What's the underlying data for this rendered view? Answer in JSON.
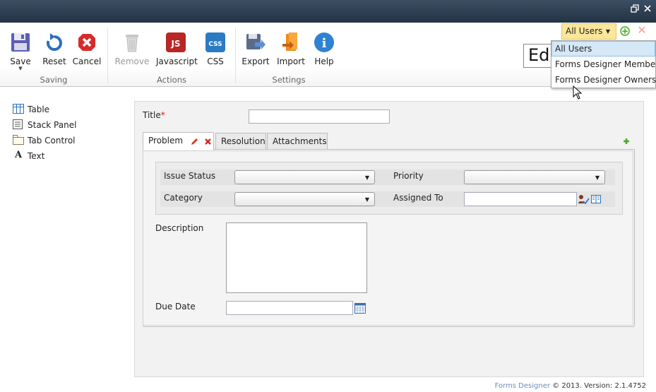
{
  "window": {
    "restore_icon": "restore-window-icon",
    "close_icon": "close-window-icon"
  },
  "ribbon": {
    "groups": [
      {
        "label": "Saving"
      },
      {
        "label": "Actions"
      },
      {
        "label": "Settings"
      }
    ],
    "buttons": {
      "save": "Save",
      "reset": "Reset",
      "cancel": "Cancel",
      "remove": "Remove",
      "javascript": "Javascript",
      "css": "CSS",
      "export": "Export",
      "import": "Import",
      "help": "Help"
    },
    "js_badge": "JS",
    "css_badge": "CSS",
    "help_badge": "i"
  },
  "user_selector": {
    "selected": "All Users",
    "options": [
      "All Users",
      "Forms Designer Members",
      "Forms Designer Owners"
    ],
    "hovered_index": 0,
    "obscured_box_text": "Edi"
  },
  "toolbox": {
    "items": [
      {
        "label": "Table",
        "icon": "table-icon"
      },
      {
        "label": "Stack Panel",
        "icon": "stack-panel-icon"
      },
      {
        "label": "Tab Control",
        "icon": "tab-control-icon"
      },
      {
        "label": "Text",
        "icon": "text-icon",
        "glyph": "A"
      }
    ]
  },
  "form": {
    "title_label": "Title",
    "required_mark": "*",
    "title_value": "",
    "tabs": [
      {
        "label": "Problem",
        "active": true
      },
      {
        "label": "Resolution",
        "active": false
      },
      {
        "label": "Attachments",
        "active": false
      }
    ],
    "fields": {
      "issue_status": {
        "label": "Issue Status",
        "value": ""
      },
      "priority": {
        "label": "Priority",
        "value": ""
      },
      "category": {
        "label": "Category",
        "value": ""
      },
      "assigned_to": {
        "label": "Assigned To",
        "value": ""
      },
      "description": {
        "label": "Description",
        "value": ""
      },
      "due_date": {
        "label": "Due Date",
        "value": ""
      }
    }
  },
  "footer": {
    "link": "Forms Designer",
    "version": "© 2013. Version: 2.1.4752"
  },
  "colors": {
    "title_bar": "#2c3d50",
    "user_dropdown": "#fbe79b",
    "menu_highlight": "#d5e8f7"
  }
}
